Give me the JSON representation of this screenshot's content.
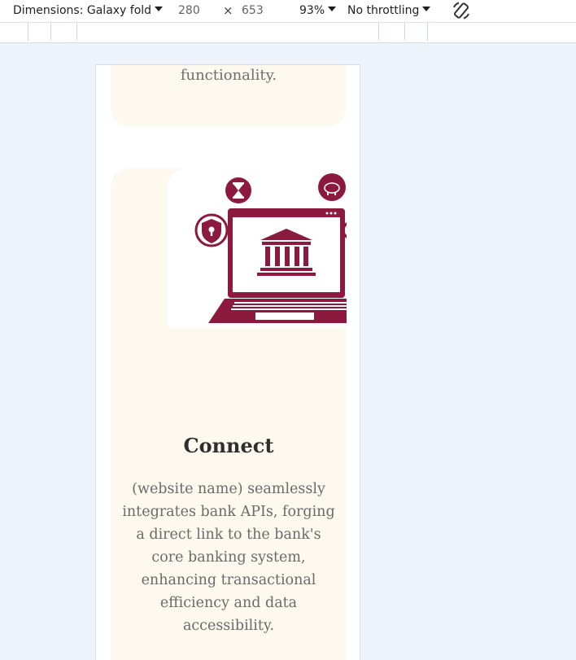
{
  "devtools": {
    "device_label": "Dimensions: Galaxy fold",
    "width": "280",
    "times": "×",
    "height": "653",
    "zoom": "93%",
    "throttling": "No throttling",
    "rotate_icon": "rotate-icon"
  },
  "page": {
    "prev_card_text": "functionality.",
    "card": {
      "title": "Connect",
      "description": "(website name) seamlessly integrates bank APIs, forging a direct link to the bank's core banking system, enhancing transactional efficiency and data accessibility.",
      "illustration_icons": [
        "hourglass-icon",
        "piggy-bank-icon",
        "shield-lock-icon",
        "laptop-icon",
        "bank-building-icon"
      ],
      "accent_color": "#8b1a3e",
      "background_color": "#fef9ee"
    }
  }
}
